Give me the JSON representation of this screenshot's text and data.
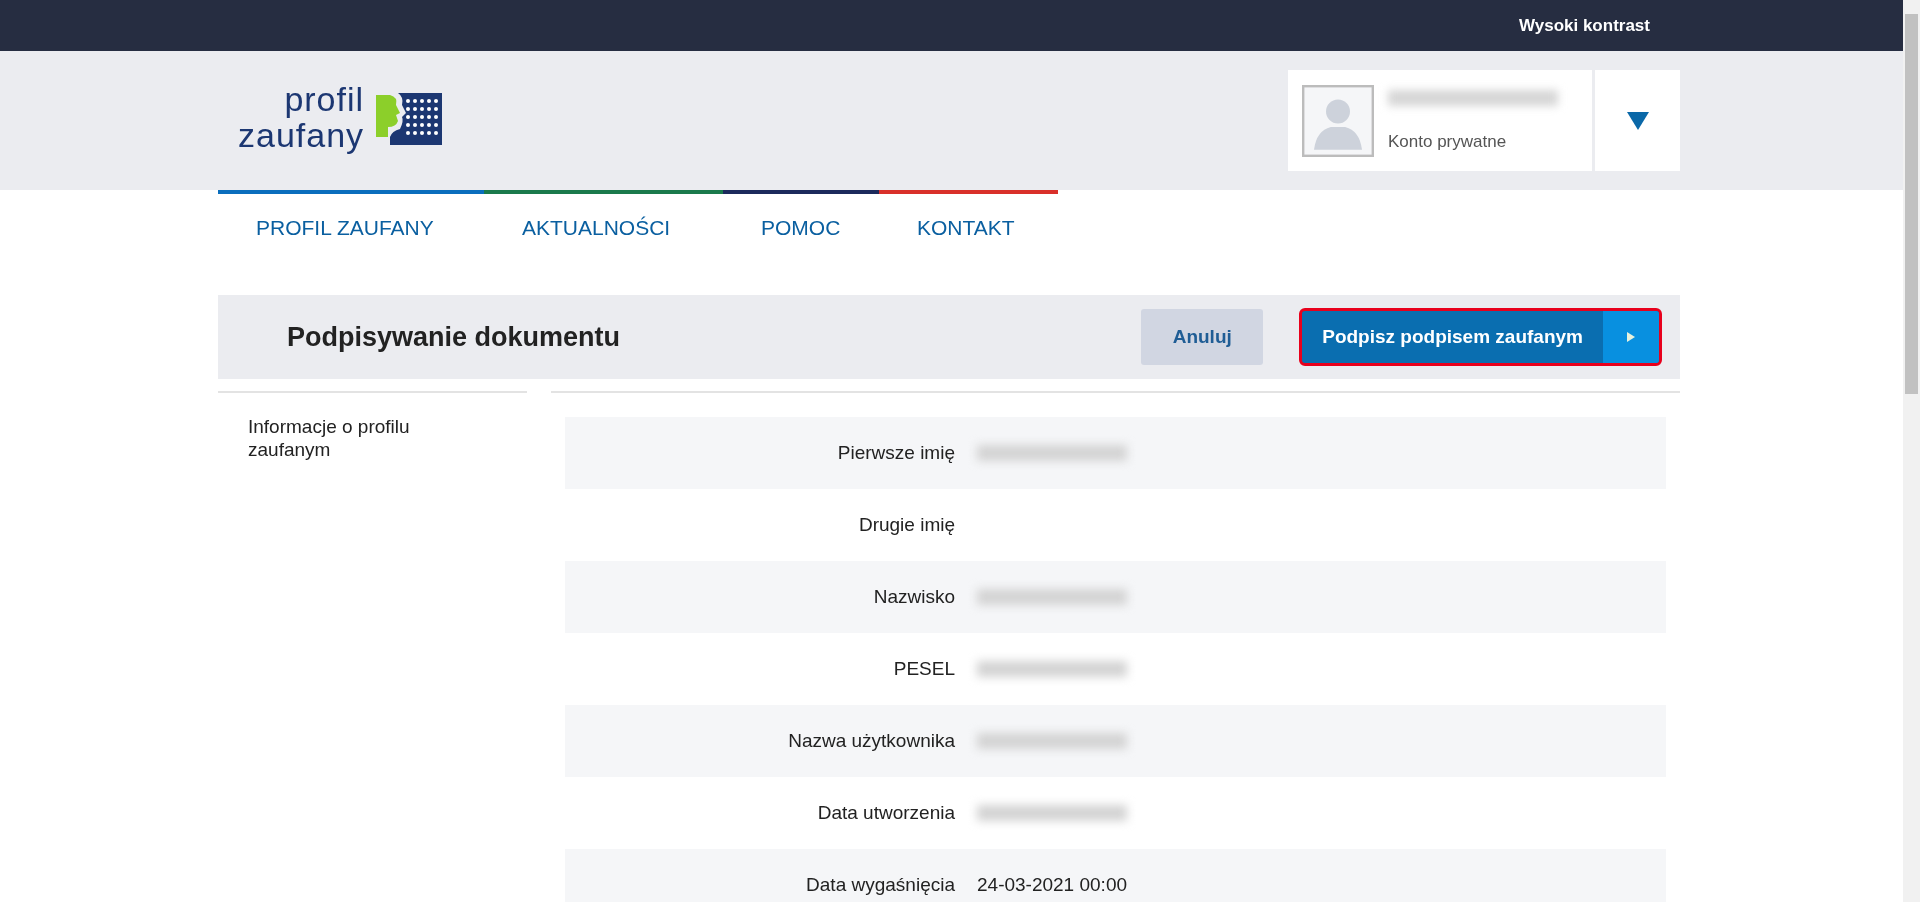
{
  "top_bar": {
    "link": "Wysoki kontrast"
  },
  "logo": {
    "line_1": "profil",
    "line_2": "zaufany"
  },
  "account": {
    "name_redacted": true,
    "type": "Konto prywatne"
  },
  "nav": [
    {
      "label": "PROFIL ZAUFANY",
      "color": "#0a6ebd"
    },
    {
      "label": "AKTUALNOŚCI",
      "color": "#1a7a4c"
    },
    {
      "label": "POMOC",
      "color": "#1c2a5c"
    },
    {
      "label": "KONTAKT",
      "color": "#d9302a"
    }
  ],
  "page": {
    "title": "Podpisywanie dokumentu",
    "cancel": "Anuluj",
    "sign": "Podpisz podpisem zaufanym"
  },
  "sidebar": {
    "items": [
      "Informacje o profilu zaufanym"
    ]
  },
  "rows": [
    {
      "label": "Pierwsze imię",
      "redacted": true
    },
    {
      "label": "Drugie imię",
      "redacted": false
    },
    {
      "label": "Nazwisko",
      "redacted": true
    },
    {
      "label": "PESEL",
      "redacted": true
    },
    {
      "label": "Nazwa użytkownika",
      "redacted": true
    },
    {
      "label": "Data utworzenia",
      "redacted": true
    },
    {
      "label": "Data wygaśnięcia",
      "redacted": false,
      "value": "24-03-2021 00:00"
    }
  ]
}
